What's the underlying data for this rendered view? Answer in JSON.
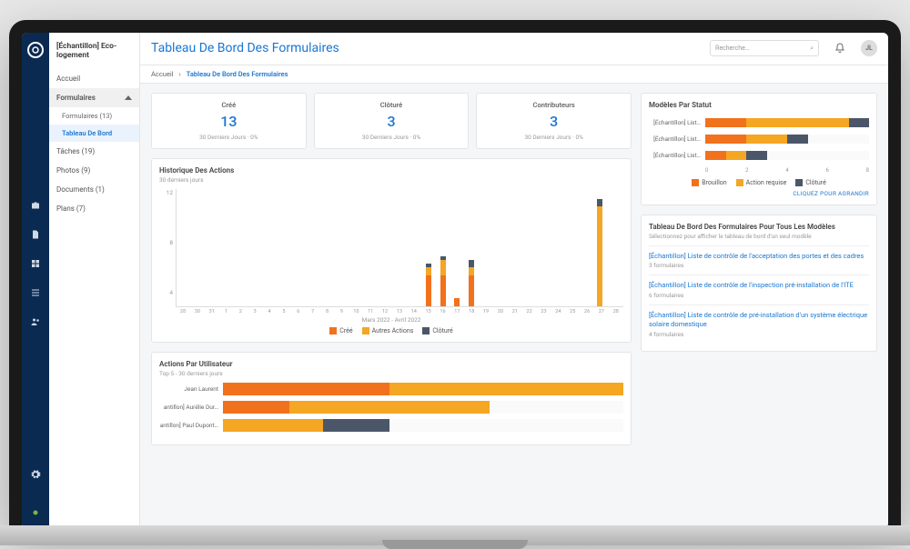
{
  "project_name": "[Échantillon] Eco-logement",
  "page_title": "Tableau De Bord Des Formulaires",
  "search_placeholder": "Recherche…",
  "avatar_initials": "JL",
  "breadcrumb_home": "Accueil",
  "breadcrumb_current": "Tableau De Bord Des Formulaires",
  "nav": {
    "accueil": "Accueil",
    "formulaires": "Formulaires",
    "formulaires_sub": "Formulaires (13)",
    "tableau": "Tableau De Bord",
    "taches": "Tâches (19)",
    "photos": "Photos (9)",
    "documents": "Documents (1)",
    "plans": "Plans (7)"
  },
  "stats": [
    {
      "label": "Créé",
      "value": "13",
      "sub": "30 Derniers Jours · 0%"
    },
    {
      "label": "Clôturé",
      "value": "3",
      "sub": "30 Derniers Jours · 0%"
    },
    {
      "label": "Contributeurs",
      "value": "3",
      "sub": "30 Derniers Jours · 0%"
    }
  ],
  "chart_data": [
    {
      "id": "history",
      "type": "bar",
      "title": "Historique Des Actions",
      "subtitle": "30 derniers jours",
      "xlabel": "Mars 2022 - Avril 2022",
      "ylabel": "",
      "ylim": [
        0,
        14
      ],
      "yticks": [
        12,
        8,
        4
      ],
      "categories": [
        "28",
        "30",
        "31",
        "1",
        "2",
        "3",
        "4",
        "5",
        "6",
        "7",
        "8",
        "9",
        "10",
        "11",
        "12",
        "13",
        "14",
        "15",
        "16",
        "17",
        "18",
        "19",
        "20",
        "21",
        "22",
        "23",
        "24",
        "25",
        "26",
        "27",
        "28"
      ],
      "series": [
        {
          "name": "Créé",
          "color": "#f2711c",
          "values": [
            0,
            0,
            0,
            0,
            0,
            0,
            0,
            0,
            0,
            0,
            0,
            0,
            0,
            0,
            0,
            0,
            0,
            4,
            4,
            1,
            4,
            0,
            0,
            0,
            0,
            0,
            0,
            0,
            0,
            0,
            0
          ]
        },
        {
          "name": "Autres Actions",
          "color": "#f5a623",
          "values": [
            0,
            0,
            0,
            0,
            0,
            0,
            0,
            0,
            0,
            0,
            0,
            0,
            0,
            0,
            0,
            0,
            0,
            1,
            2,
            0,
            1,
            0,
            0,
            0,
            0,
            0,
            0,
            0,
            0,
            13,
            0
          ]
        },
        {
          "name": "Clôturé",
          "color": "#4b5769",
          "values": [
            0,
            0,
            0,
            0,
            0,
            0,
            0,
            0,
            0,
            0,
            0,
            0,
            0,
            0,
            0,
            0,
            0,
            0.5,
            0.5,
            0,
            1,
            0,
            0,
            0,
            0,
            0,
            0,
            0,
            0,
            1,
            0
          ]
        }
      ]
    },
    {
      "id": "users",
      "type": "bar",
      "orientation": "horizontal",
      "title": "Actions Par Utilisateur",
      "subtitle": "Top 5 - 30 derniers jours",
      "categories": [
        "Jean Laurent",
        "antillon] Aurélie Dur…",
        "antillon] Paul Dupont…"
      ],
      "series": [
        {
          "name": "Créé",
          "color": "#f2711c",
          "values": [
            10,
            4,
            0
          ]
        },
        {
          "name": "Autres Actions",
          "color": "#f5a623",
          "values": [
            14,
            12,
            6
          ]
        },
        {
          "name": "Clôturé",
          "color": "#4b5769",
          "values": [
            0,
            0,
            4
          ]
        }
      ]
    },
    {
      "id": "status",
      "type": "bar",
      "orientation": "horizontal",
      "title": "Modèles Par Statut",
      "xlim": [
        0,
        8
      ],
      "xticks": [
        "0",
        "2",
        "4",
        "6",
        "8"
      ],
      "categories": [
        "[Échantillon] List…",
        "[Échantillon] List…",
        "[Échantillon] List…"
      ],
      "series": [
        {
          "name": "Brouillon",
          "color": "#f2711c",
          "values": [
            2,
            2,
            1
          ]
        },
        {
          "name": "Action requise",
          "color": "#f5a623",
          "values": [
            5,
            2,
            1
          ]
        },
        {
          "name": "Clôturé",
          "color": "#4b5769",
          "values": [
            1,
            1,
            1
          ]
        }
      ],
      "expand_label": "CLIQUEZ POUR AGRANDIR"
    }
  ],
  "models_section": {
    "title": "Tableau De Bord Des Formulaires Pour Tous Les Modèles",
    "hint": "Sélectionnez pour afficher le tableau de bord d'un seul modèle",
    "items": [
      {
        "title": "[Échantillon] Liste de contrôle de l'acceptation des portes et des cadres",
        "count": "3 formulaires"
      },
      {
        "title": "[Échantillon] Liste de contrôle de l'inspection pré-installation de l'ITE",
        "count": "6 formulaires"
      },
      {
        "title": "[Échantillon] Liste de contrôle de pré-installation d'un système électrique solaire domestique",
        "count": "4 formulaires"
      }
    ]
  }
}
